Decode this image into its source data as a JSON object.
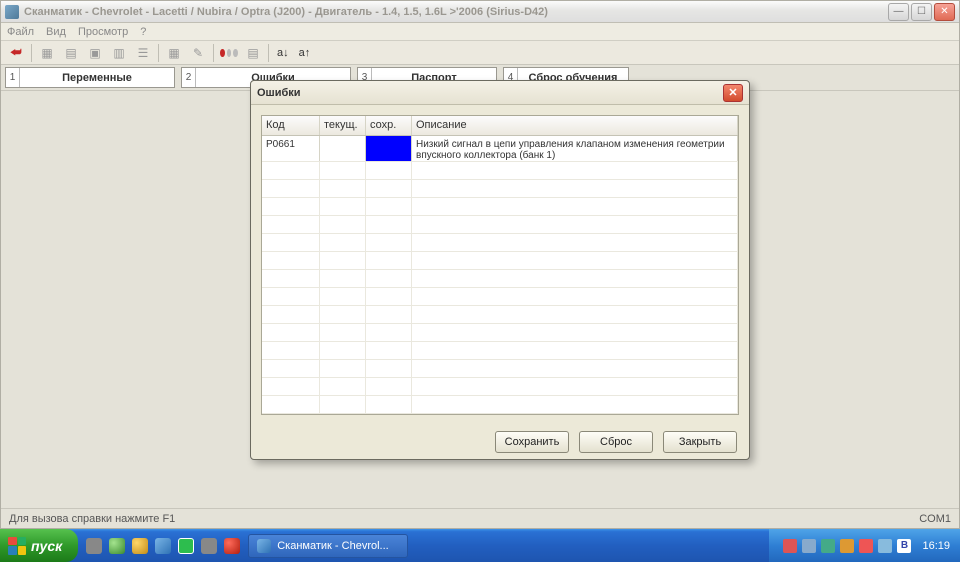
{
  "window": {
    "title": "Сканматик - Chevrolet - Lacetti / Nubira / Optra (J200) - Двигатель - 1.4, 1.5, 1.6L >'2006 (Sirius-D42)"
  },
  "menu": {
    "file": "Файл",
    "view": "Вид",
    "watch": "Просмотр",
    "help": "?"
  },
  "toolbar": {
    "a_inc": "a↓",
    "a_dec": "a↑"
  },
  "tabs": [
    {
      "num": "1",
      "label": "Переменные"
    },
    {
      "num": "2",
      "label": "Ошибки"
    },
    {
      "num": "3",
      "label": "Паспорт"
    },
    {
      "num": "4",
      "label": "Сброс обучения"
    }
  ],
  "status": {
    "help": "Для вызова справки нажмите F1",
    "port": "COM1"
  },
  "dialog": {
    "title": "Ошибки",
    "columns": {
      "code": "Код",
      "current": "текущ.",
      "saved": "сохр.",
      "desc": "Описание"
    },
    "rows": [
      {
        "code": "P0661",
        "current": "",
        "saved": "",
        "desc": "Низкий сигнал в цепи управления клапаном изменения геометрии впускного коллектора (банк 1)"
      }
    ],
    "buttons": {
      "save": "Сохранить",
      "reset": "Сброс",
      "close": "Закрыть"
    }
  },
  "taskbar": {
    "start": "пуск",
    "app": "Сканматик - Chevrol...",
    "clock": "16:19",
    "lang": "B"
  }
}
